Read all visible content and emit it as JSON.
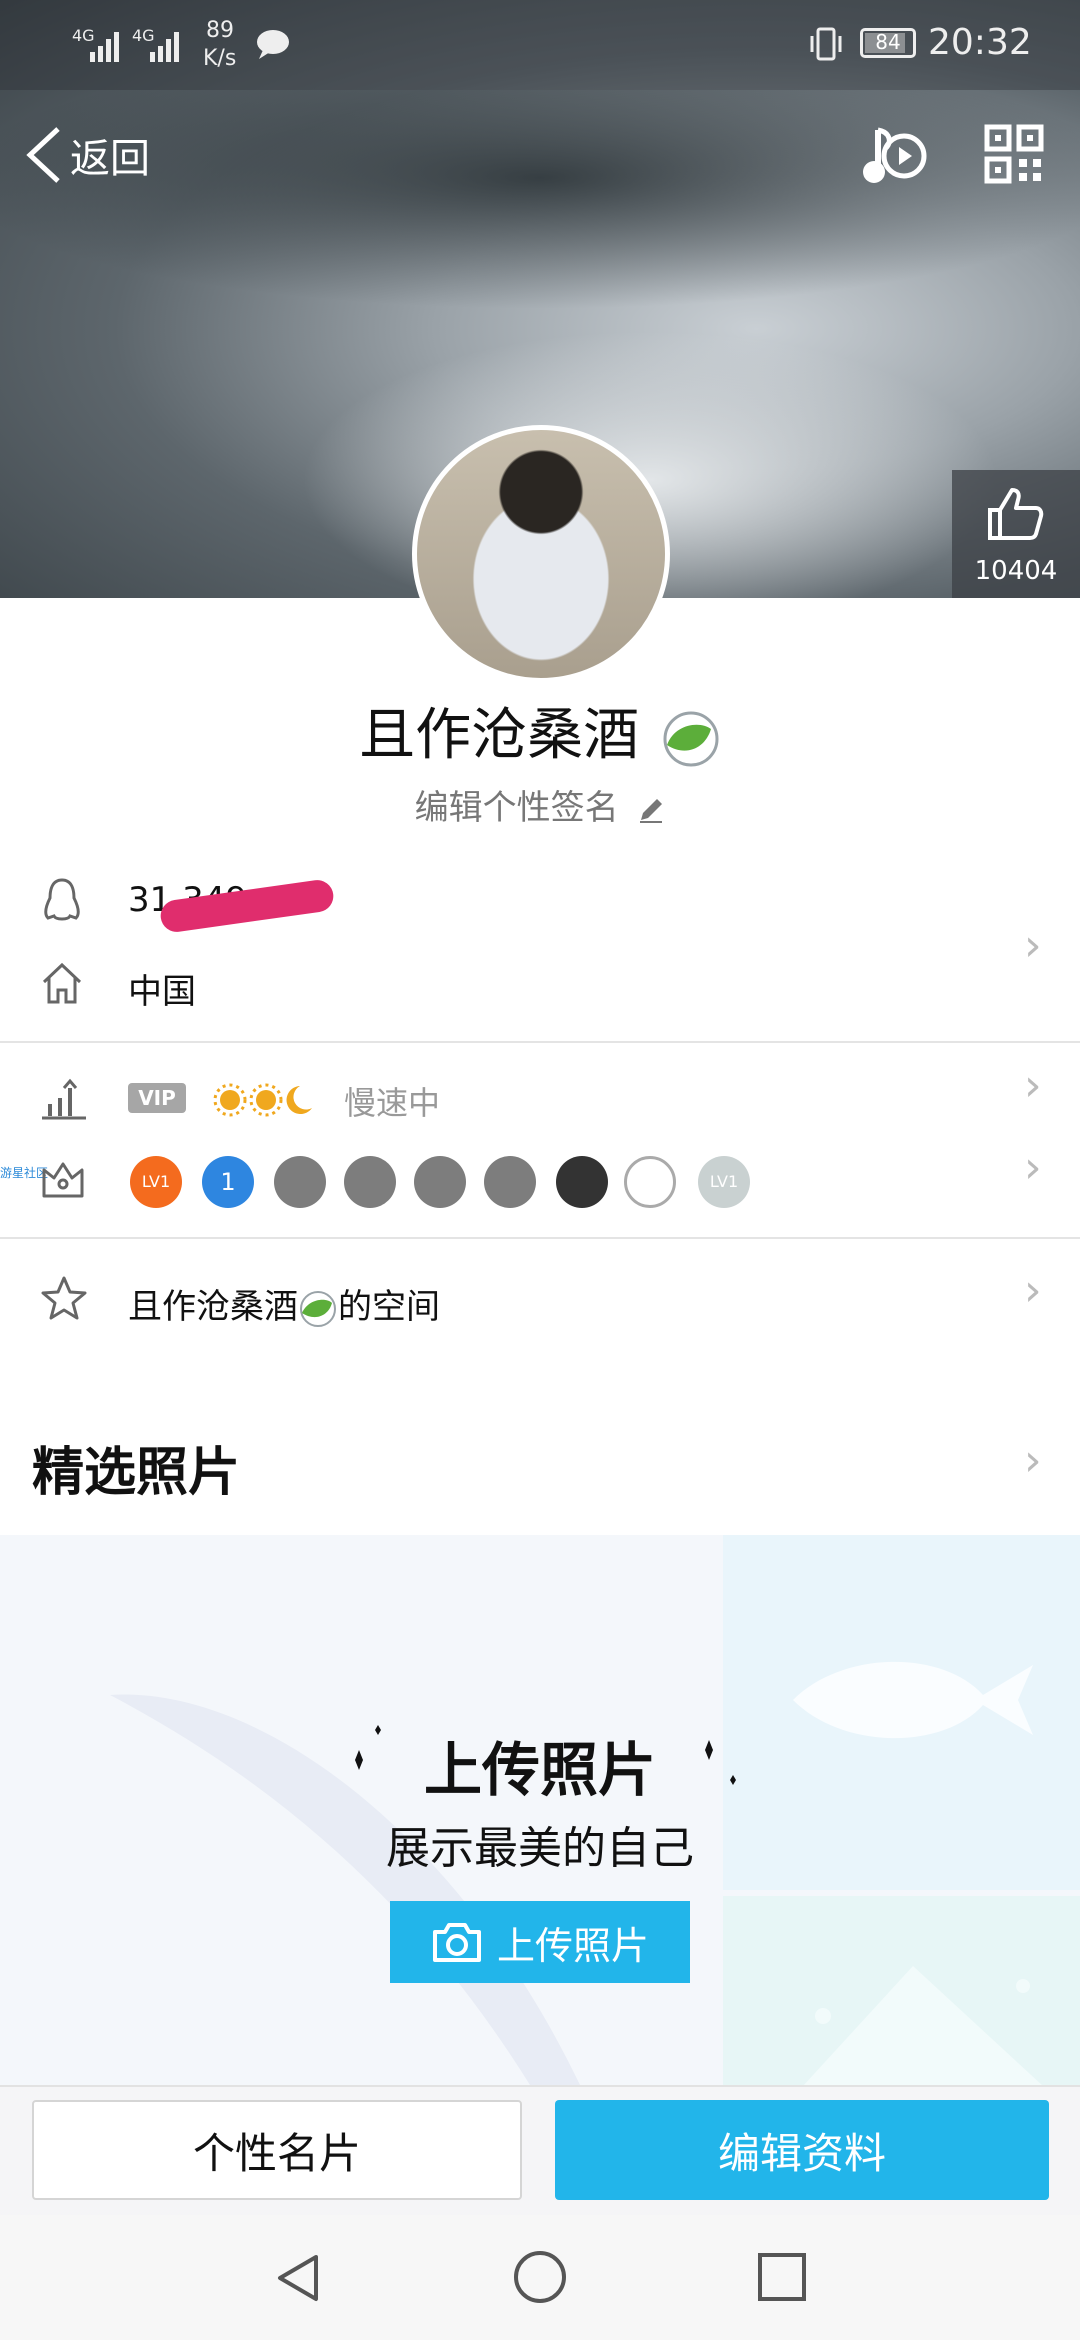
{
  "status_bar": {
    "net1": "4G",
    "net2": "4G",
    "speed_value": "89",
    "speed_unit": "K/s",
    "battery": "84",
    "time": "20:32"
  },
  "header": {
    "back_label": "返回",
    "like_count": "10404"
  },
  "profile": {
    "name": "且作沧桑酒",
    "signature": "编辑个性签名"
  },
  "info": {
    "qq_number": "31         349",
    "location": "中国",
    "vip_label": "VIP",
    "level_status": "慢速中",
    "badge_caption": "游星社区",
    "badges": [
      "LV1",
      "1",
      "",
      "",
      "",
      "",
      "",
      "",
      "LV1"
    ],
    "space_label": "且作沧桑酒",
    "space_suffix": "的空间"
  },
  "photos": {
    "section_title": "精选照片",
    "upload_title": "上传照片",
    "upload_subtitle": "展示最美的自己",
    "upload_button": "上传照片"
  },
  "actions": {
    "card_label": "个性名片",
    "edit_label": "编辑资料"
  },
  "colors": {
    "accent": "#22b5ea",
    "vip_gray": "#a6a6a6"
  }
}
